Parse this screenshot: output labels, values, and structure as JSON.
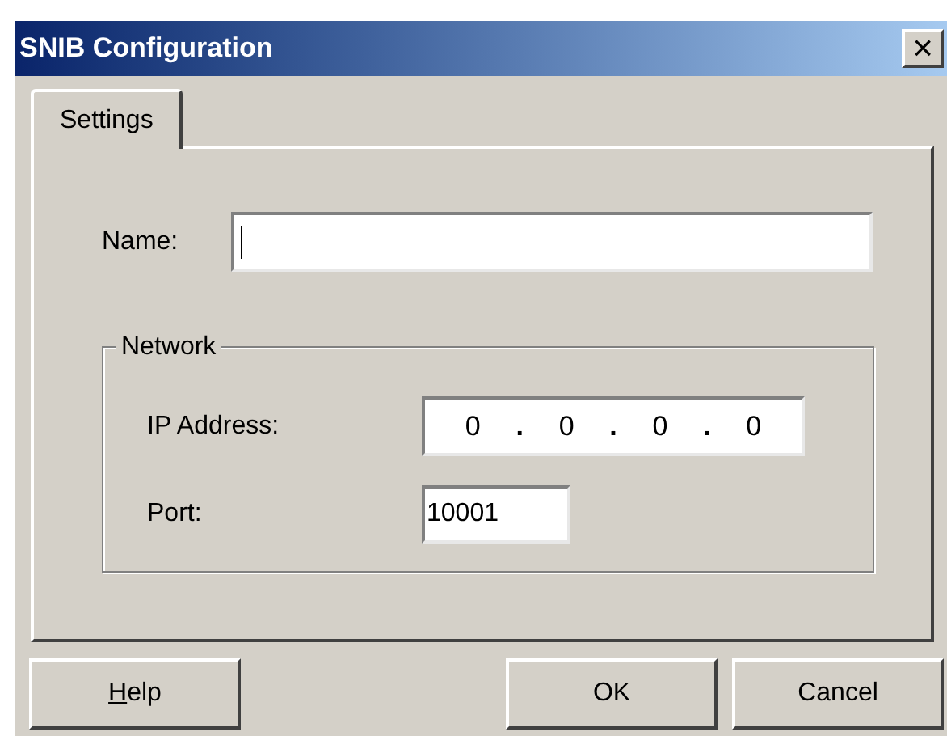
{
  "window": {
    "title": "SNIB Configuration",
    "close_glyph": "×"
  },
  "tabs": [
    {
      "label": "Settings",
      "selected": true
    }
  ],
  "name_field": {
    "label": "Name:",
    "focused": true
  },
  "network": {
    "title": "Network",
    "ip_address": {
      "label": "IP Address:",
      "parts": [
        "0",
        ".",
        "0",
        ".",
        "0",
        ".",
        "0"
      ]
    },
    "port": {
      "label": "Port:",
      "value": "10001"
    }
  },
  "buttons": [
    {
      "kind": "help",
      "mnemonic": "H",
      "rest": "elp"
    },
    {
      "kind": "action",
      "rest": "OK"
    },
    {
      "kind": "action",
      "rest": "Cancel"
    }
  ]
}
